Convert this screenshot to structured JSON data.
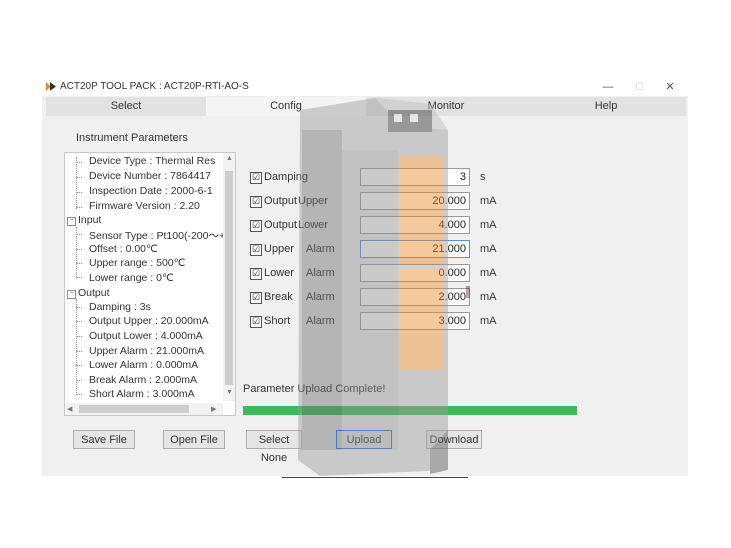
{
  "window": {
    "title": "ACT20P TOOL PACK : ACT20P-RTI-AO-S",
    "app_icon": "act20p-logo-icon",
    "controls": {
      "minimize": "—",
      "maximize": "□",
      "close": "✕"
    }
  },
  "tabs": [
    {
      "label": "Select"
    },
    {
      "label": "Config"
    },
    {
      "label": "Monitor"
    },
    {
      "label": "Help"
    }
  ],
  "instrument": {
    "heading": "Instrument Parameters",
    "tree": [
      "Device Type : Thermal Res",
      "Device Number : 7864417",
      "Inspection Date : 2000-6-1",
      "Firmware Version : 2.20",
      "Input",
      "Sensor Type : Pt100(-200～+",
      "Offset : 0.00℃",
      "Upper range : 500℃",
      "Lower range : 0℃",
      "Output",
      "Damping : 3s",
      "Output   Upper : 20.000mA",
      "Output   Lower : 4.000mA",
      "Upper     Alarm : 21.000mA",
      "Lower     Alarm : 0.000mA",
      "Break     Alarm : 2.000mA",
      "Short     Alarm : 3.000mA"
    ],
    "expander_symbol": "−"
  },
  "params": [
    {
      "label": "Damping",
      "label2": "",
      "value": "3",
      "unit": "s",
      "checked": "☑"
    },
    {
      "label": "Output",
      "label2": "Upper",
      "value": "20.000",
      "unit": "mA",
      "checked": "☑"
    },
    {
      "label": "Output",
      "label2": "Lower",
      "value": "4.000",
      "unit": "mA",
      "checked": "☑"
    },
    {
      "label": "Upper",
      "label2": "Alarm",
      "value": "21.000",
      "unit": "mA",
      "checked": "☑"
    },
    {
      "label": "Lower",
      "label2": "Alarm",
      "value": "0.000",
      "unit": "mA",
      "checked": "☑"
    },
    {
      "label": "Break",
      "label2": "Alarm",
      "value": "2.000",
      "unit": "mA",
      "checked": "☑"
    },
    {
      "label": "Short",
      "label2": "Alarm",
      "value": "3.000",
      "unit": "mA",
      "checked": "☑"
    }
  ],
  "status": {
    "message": "Parameter Upload Complete!",
    "progress": 1.0,
    "progress_color": "#3fba58"
  },
  "buttons": {
    "save": "Save File",
    "open": "Open File",
    "select_none": "Select None",
    "upload": "Upload",
    "download": "Download"
  },
  "colors": {
    "accent": "#2f7cd4",
    "device_orange": "#e8892a"
  }
}
